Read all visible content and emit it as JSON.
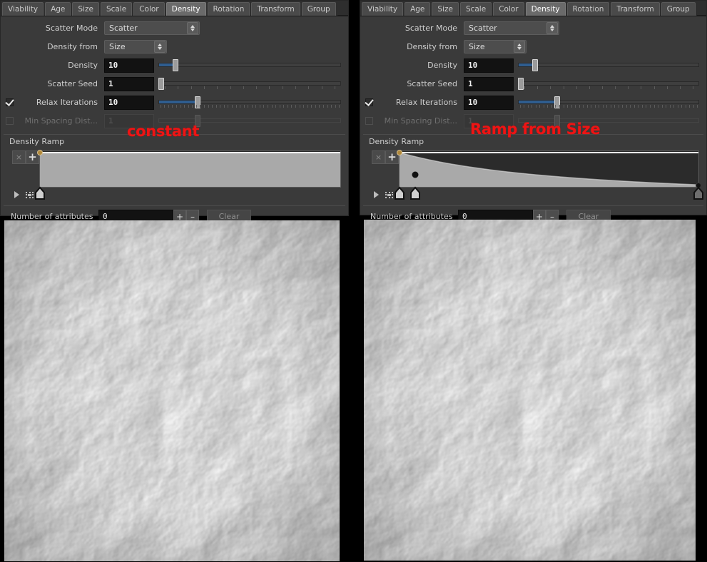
{
  "app": {
    "theme_bg": "#3a3a3a",
    "accent_blue": "#2f5d8f",
    "annotation_color": "#ee1414"
  },
  "tabs": [
    {
      "label": "Viability",
      "active": false
    },
    {
      "label": "Age",
      "active": false
    },
    {
      "label": "Size",
      "active": false
    },
    {
      "label": "Scale",
      "active": false
    },
    {
      "label": "Color",
      "active": false
    },
    {
      "label": "Density",
      "active": true
    },
    {
      "label": "Rotation",
      "active": false
    },
    {
      "label": "Transform",
      "active": false
    },
    {
      "label": "Group",
      "active": false
    }
  ],
  "panel": {
    "scatter_mode": {
      "label": "Scatter Mode",
      "value": "Scatter"
    },
    "density_from": {
      "label": "Density from",
      "value": "Size"
    },
    "density": {
      "label": "Density",
      "value": "10",
      "slider_pct": 9
    },
    "scatter_seed": {
      "label": "Scatter Seed",
      "value": "1",
      "slider_pct": 1
    },
    "relax_iterations": {
      "label": "Relax Iterations",
      "value": "10",
      "slider_pct": 21,
      "checked": true
    },
    "min_spacing": {
      "label": "Min Spacing Dist...",
      "value": "1",
      "slider_pct": 20,
      "checked": false,
      "disabled": true
    },
    "ramp_title": "Density Ramp",
    "ramp_buttons": {
      "delete": "×",
      "add": "+"
    },
    "attributes": {
      "label": "Number of attributes",
      "value": "0",
      "plus": "+",
      "minus": "–",
      "clear": "Clear"
    }
  },
  "left": {
    "annotation": "constant",
    "ramp_description": "flat constant ramp at full value across entire range",
    "ramp_keys": [
      {
        "pos": 0.0,
        "value": 1.0
      }
    ]
  },
  "right": {
    "annotation": "Ramp from Size",
    "ramp_description": "ramp decaying from full value at left to near zero at right",
    "ramp_keys": [
      {
        "pos": 0.0,
        "value": 1.0
      },
      {
        "pos": 0.085,
        "value": 0.78
      },
      {
        "pos": 1.0,
        "value": 0.04
      }
    ]
  },
  "viewports": {
    "left": {
      "name": "scatter-preview-constant-density"
    },
    "right": {
      "name": "scatter-preview-size-ramp-density"
    }
  }
}
